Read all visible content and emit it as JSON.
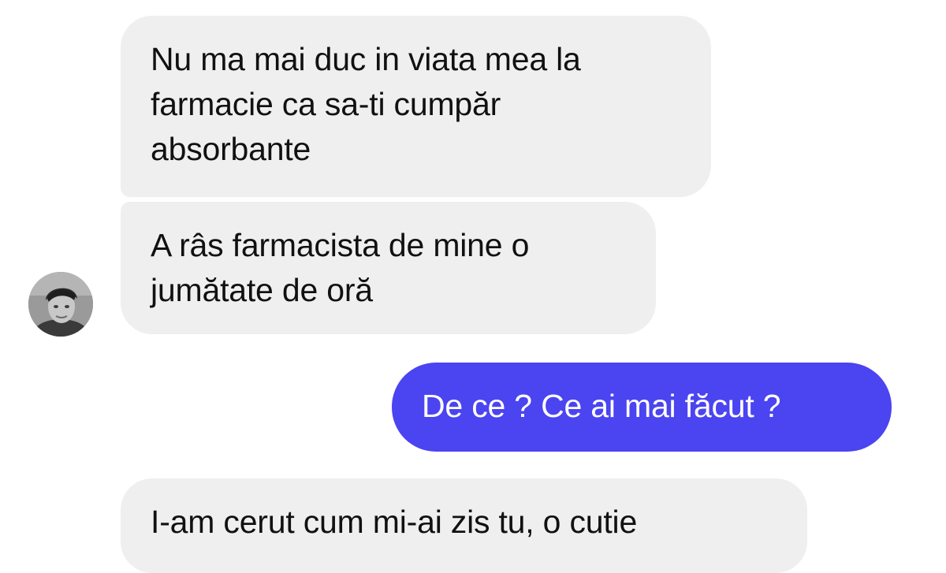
{
  "conversation": {
    "messages": [
      {
        "direction": "incoming",
        "lines": [
          "Nu ma mai duc in viata mea la",
          "farmacie ca sa-ti cumpăr",
          "absorbante"
        ]
      },
      {
        "direction": "incoming",
        "lines": [
          "A râs farmacista de mine o",
          "jumătate de oră"
        ]
      },
      {
        "direction": "outgoing",
        "lines": [
          "De ce  ? Ce ai mai făcut ?"
        ]
      },
      {
        "direction": "incoming",
        "lines": [
          "I-am cerut cum mi-ai zis tu, o cutie"
        ]
      }
    ],
    "colors": {
      "incoming_bubble": "#efefef",
      "outgoing_bubble": "#4b44f1",
      "incoming_text": "#111111",
      "outgoing_text": "#ffffff"
    },
    "avatar_icon": "contact-avatar-photo"
  }
}
